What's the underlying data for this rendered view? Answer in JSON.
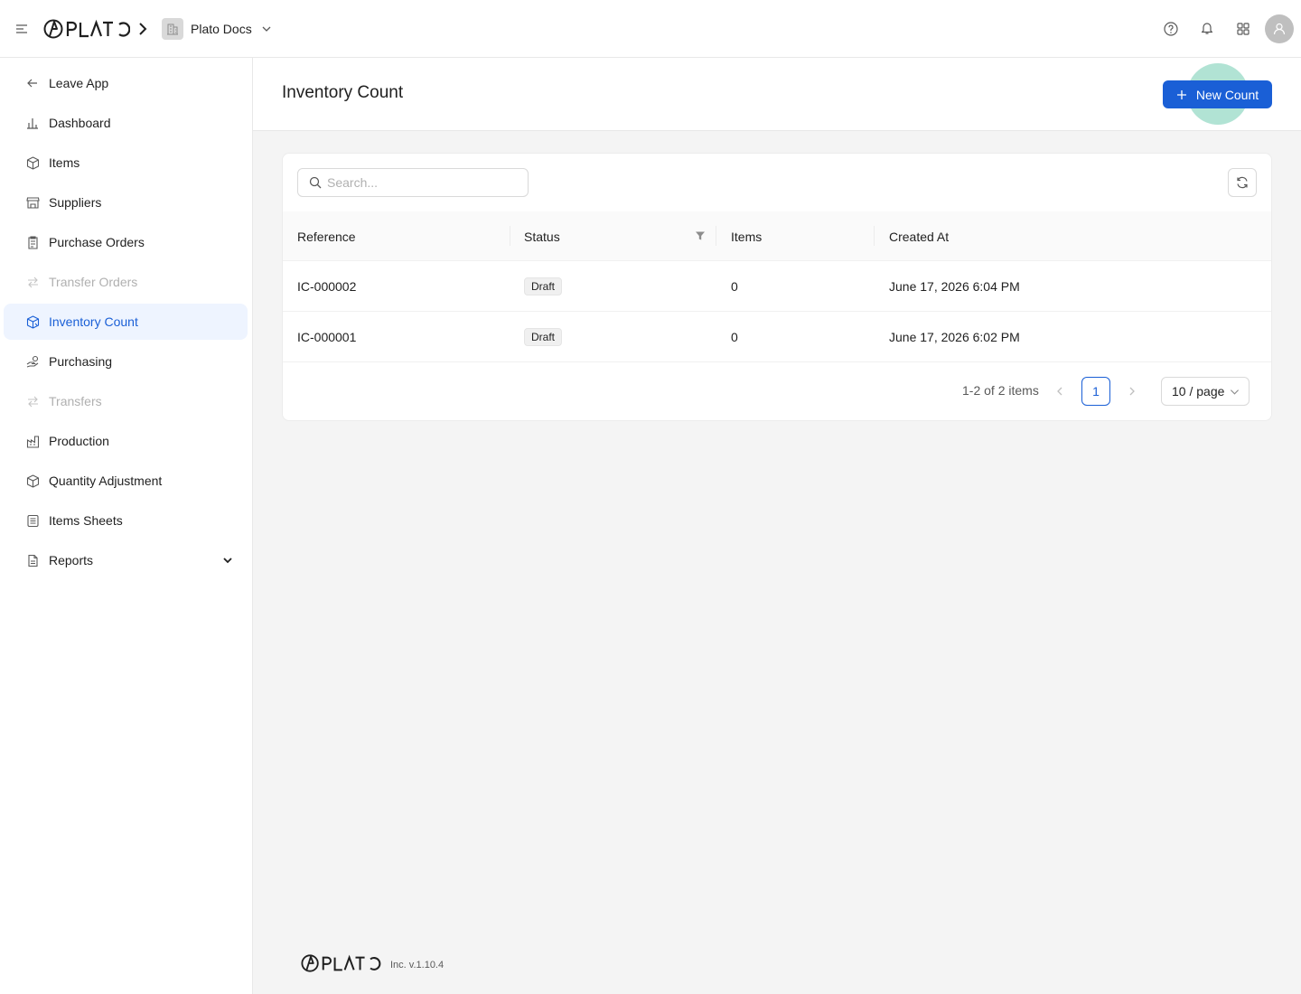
{
  "header": {
    "org_name": "Plato Docs"
  },
  "sidebar": {
    "items": [
      {
        "label": "Leave App",
        "icon": "arrow-left-icon"
      },
      {
        "label": "Dashboard",
        "icon": "bar-chart-icon"
      },
      {
        "label": "Items",
        "icon": "box-icon"
      },
      {
        "label": "Suppliers",
        "icon": "store-icon"
      },
      {
        "label": "Purchase Orders",
        "icon": "clipboard-icon"
      },
      {
        "label": "Transfer Orders",
        "icon": "transfer-icon",
        "disabled": true
      },
      {
        "label": "Inventory Count",
        "icon": "boxes-count-icon",
        "active": true
      },
      {
        "label": "Purchasing",
        "icon": "hand-coins-icon"
      },
      {
        "label": "Transfers",
        "icon": "transfer-icon",
        "disabled": true
      },
      {
        "label": "Production",
        "icon": "factory-icon"
      },
      {
        "label": "Quantity Adjustment",
        "icon": "box-adjust-icon"
      },
      {
        "label": "Items Sheets",
        "icon": "sheet-icon"
      },
      {
        "label": "Reports",
        "icon": "report-icon",
        "expandable": true
      }
    ]
  },
  "page": {
    "title": "Inventory Count",
    "new_button_label": "New Count",
    "search_placeholder": "Search..."
  },
  "table": {
    "columns": [
      "Reference",
      "Status",
      "Items",
      "Created At"
    ],
    "rows": [
      {
        "reference": "IC-000002",
        "status": "Draft",
        "items": "0",
        "created_at": "June 17, 2026 6:04 PM"
      },
      {
        "reference": "IC-000001",
        "status": "Draft",
        "items": "0",
        "created_at": "June 17, 2026 6:02 PM"
      }
    ]
  },
  "pagination": {
    "total_text": "1-2 of 2 items",
    "current_page": "1",
    "page_size": "10 / page"
  },
  "footer": {
    "version": "Inc. v.1.10.4"
  },
  "colors": {
    "accent": "#1a5fd6",
    "active_bg": "#eef4ff",
    "content_bg": "#f4f4f4"
  }
}
